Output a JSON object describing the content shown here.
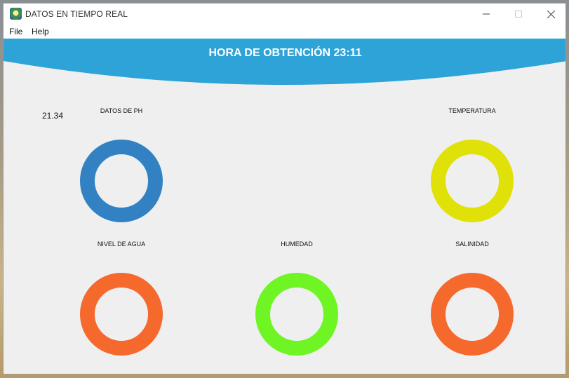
{
  "window": {
    "title": "DATOS EN TIEMPO REAL",
    "controls": {
      "minimize": "–",
      "maximize": "☐",
      "close": "✕"
    }
  },
  "menu": {
    "file": "File",
    "help": "Help"
  },
  "header": {
    "title": "HORA DE OBTENCIÓN 23:11",
    "color": "#2ea3d8"
  },
  "gauges": {
    "ph": {
      "label": "DATOS DE PH",
      "value": "21.34",
      "color": "#3282c3"
    },
    "temperatura": {
      "label": "TEMPERATURA",
      "color": "#e1e10a"
    },
    "nivel_agua": {
      "label": "NIVEL DE AGUA",
      "color": "#f5692d"
    },
    "humedad": {
      "label": "HUMEDAD",
      "color": "#6ef523"
    },
    "salinidad": {
      "label": "SALINIDAD",
      "color": "#f5692d"
    }
  }
}
